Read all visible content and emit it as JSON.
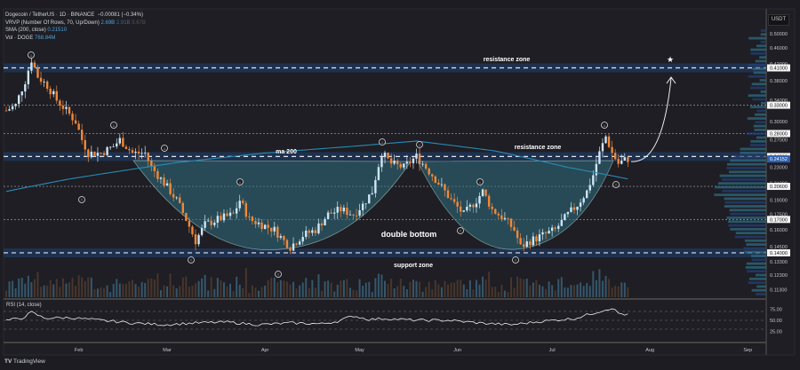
{
  "header": {
    "symbol_line": "Dogecoin / TetherUS · 1D · BINANCE",
    "change": "−0.00081 (−0.34%)",
    "vrvp_label": "VRVP (Number Of Rows, 70, Up/Down)",
    "vrvp_values": [
      "2.69B",
      "2.91B",
      "5.67B"
    ],
    "sma_label": "SMA (200, close)",
    "sma_value": "0.21510",
    "vol_label": "Vol · DOGE",
    "vol_value": "768.84M",
    "currency": "USDT"
  },
  "rsi": {
    "label": "RSI (14, close)",
    "ticks": [
      "75.00",
      "50.00",
      "25.00"
    ]
  },
  "footer": {
    "brand": "TradingView"
  },
  "colors": {
    "bg": "#1c1c22",
    "up": "#cde6f7",
    "down": "#f0883a",
    "ma": "#2a8bb5",
    "zone": "#1f3557",
    "fill": "#2f6f80"
  },
  "chart_data": {
    "type": "candlestick",
    "title": "Dogecoin / TetherUS · 1D · BINANCE",
    "yscale": "log",
    "ylim": [
      0.105,
      0.52
    ],
    "price_ticks": [
      "0.50000",
      "0.46000",
      "0.42000",
      "0.38000",
      "0.34000",
      "0.30000",
      "0.27000",
      "0.23000",
      "0.21000",
      "0.19000",
      "0.17500",
      "0.16000",
      "0.14500",
      "0.13300",
      "0.12300",
      "0.11300"
    ],
    "price_labels": [
      {
        "text": "0.41000",
        "value": 0.41,
        "style": "line"
      },
      {
        "text": "0.33000",
        "value": 0.33,
        "style": "line"
      },
      {
        "text": "0.28000",
        "value": 0.28,
        "style": "line"
      },
      {
        "text": "0.24500",
        "value": 0.245,
        "style": "line"
      },
      {
        "text": "0.24152",
        "value": 0.24152,
        "style": "last"
      },
      {
        "text": "0.20600",
        "value": 0.206,
        "style": "line"
      },
      {
        "text": "0.17000",
        "value": 0.17,
        "style": "line"
      },
      {
        "text": "0.14000",
        "value": 0.14,
        "style": "line"
      }
    ],
    "x_ticks": [
      {
        "label": "Feb",
        "day": 23
      },
      {
        "label": "Mar",
        "day": 51
      },
      {
        "label": "Apr",
        "day": 82
      },
      {
        "label": "May",
        "day": 112
      },
      {
        "label": "Jun",
        "day": 143
      },
      {
        "label": "Jul",
        "day": 173
      },
      {
        "label": "Aug",
        "day": 204
      },
      {
        "label": "Sep",
        "day": 235
      }
    ],
    "price_anchors": [
      [
        0,
        0.32
      ],
      [
        3,
        0.33
      ],
      [
        6,
        0.38
      ],
      [
        8,
        0.43
      ],
      [
        10,
        0.39
      ],
      [
        13,
        0.37
      ],
      [
        16,
        0.34
      ],
      [
        19,
        0.32
      ],
      [
        22,
        0.3
      ],
      [
        24,
        0.27
      ],
      [
        26,
        0.25
      ],
      [
        30,
        0.25
      ],
      [
        34,
        0.26
      ],
      [
        36,
        0.27
      ],
      [
        40,
        0.25
      ],
      [
        44,
        0.25
      ],
      [
        46,
        0.23
      ],
      [
        50,
        0.21
      ],
      [
        54,
        0.19
      ],
      [
        57,
        0.17
      ],
      [
        60,
        0.15
      ],
      [
        63,
        0.165
      ],
      [
        67,
        0.17
      ],
      [
        72,
        0.175
      ],
      [
        74,
        0.19
      ],
      [
        77,
        0.17
      ],
      [
        81,
        0.165
      ],
      [
        85,
        0.16
      ],
      [
        88,
        0.15
      ],
      [
        90,
        0.145
      ],
      [
        94,
        0.155
      ],
      [
        98,
        0.16
      ],
      [
        102,
        0.175
      ],
      [
        106,
        0.18
      ],
      [
        110,
        0.175
      ],
      [
        113,
        0.185
      ],
      [
        116,
        0.2
      ],
      [
        119,
        0.25
      ],
      [
        122,
        0.235
      ],
      [
        126,
        0.23
      ],
      [
        130,
        0.245
      ],
      [
        133,
        0.23
      ],
      [
        137,
        0.21
      ],
      [
        141,
        0.19
      ],
      [
        145,
        0.175
      ],
      [
        149,
        0.19
      ],
      [
        151,
        0.2
      ],
      [
        154,
        0.18
      ],
      [
        158,
        0.17
      ],
      [
        161,
        0.16
      ],
      [
        163,
        0.145
      ],
      [
        166,
        0.15
      ],
      [
        170,
        0.155
      ],
      [
        174,
        0.16
      ],
      [
        178,
        0.175
      ],
      [
        181,
        0.185
      ],
      [
        184,
        0.2
      ],
      [
        186,
        0.22
      ],
      [
        188,
        0.25
      ],
      [
        190,
        0.275
      ],
      [
        192,
        0.25
      ],
      [
        194,
        0.235
      ],
      [
        196,
        0.24
      ],
      [
        197,
        0.2415
      ]
    ],
    "sma200": [
      [
        0,
        0.2
      ],
      [
        20,
        0.215
      ],
      [
        55,
        0.237
      ],
      [
        82,
        0.25
      ],
      [
        110,
        0.26
      ],
      [
        130,
        0.268
      ],
      [
        155,
        0.253
      ],
      [
        178,
        0.23
      ],
      [
        197,
        0.2151
      ]
    ],
    "rsi_anchors": [
      [
        0,
        50
      ],
      [
        5,
        55
      ],
      [
        8,
        68
      ],
      [
        12,
        55
      ],
      [
        20,
        56
      ],
      [
        30,
        50
      ],
      [
        40,
        44
      ],
      [
        50,
        40
      ],
      [
        60,
        44
      ],
      [
        70,
        46
      ],
      [
        80,
        40
      ],
      [
        90,
        44
      ],
      [
        100,
        42
      ],
      [
        105,
        48
      ],
      [
        110,
        60
      ],
      [
        115,
        52
      ],
      [
        120,
        54
      ],
      [
        130,
        50
      ],
      [
        140,
        50
      ],
      [
        150,
        44
      ],
      [
        160,
        40
      ],
      [
        170,
        48
      ],
      [
        180,
        54
      ],
      [
        188,
        70
      ],
      [
        192,
        78
      ],
      [
        194,
        66
      ],
      [
        197,
        62
      ]
    ],
    "volume_profile_note": "",
    "zones": [
      {
        "label": "resistance zone",
        "value": 0.41
      },
      {
        "label": "resistance zone",
        "value": 0.245
      },
      {
        "label": "support zone",
        "value": 0.14
      }
    ],
    "annotations": {
      "ma": "ma 200",
      "pattern": "double bottom"
    }
  }
}
